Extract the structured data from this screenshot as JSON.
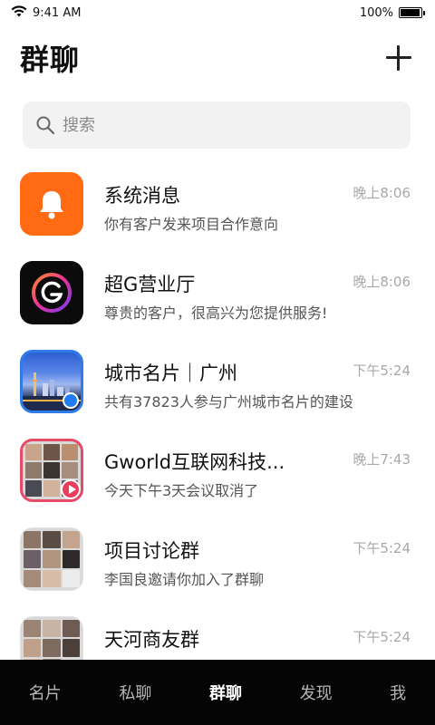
{
  "status_bar": {
    "time": "9:41 AM",
    "battery": "100%",
    "battery_level": 1.0
  },
  "header": {
    "title": "群聊",
    "add_icon": "plus-icon"
  },
  "search": {
    "placeholder": "搜索",
    "icon": "search-icon"
  },
  "chats": [
    {
      "name": "系统消息",
      "preview": "你有客户发来项目合作意向",
      "time": "晚上8:06",
      "avatar": "bell-icon",
      "color": "#ff6a13"
    },
    {
      "name": "超G营业厅",
      "preview": "尊贵的客户，很高兴为您提供服务!",
      "time": "晚上8:06",
      "avatar": "g-logo",
      "color": "#0b0b0b"
    },
    {
      "name": "城市名片｜广州",
      "preview": "共有37823人参与广州城市名片的建设",
      "time": "下午5:24",
      "avatar": "city-photo",
      "color": "#2f7be8"
    },
    {
      "name": "Gworld互联网科技...",
      "preview": "今天下午3天会议取消了",
      "time": "晚上7:43",
      "avatar": "group-collage",
      "color": "#e54a67"
    },
    {
      "name": "项目讨论群",
      "preview": "李国良邀请你加入了群聊",
      "time": "下午5:24",
      "avatar": "group-collage",
      "color": "#d9d9d9"
    },
    {
      "name": "天河商友群",
      "preview": "",
      "time": "下午5:24",
      "avatar": "group-collage",
      "color": "#d9d9d9"
    }
  ],
  "tabs": [
    {
      "label": "名片",
      "active": false
    },
    {
      "label": "私聊",
      "active": false
    },
    {
      "label": "群聊",
      "active": true
    },
    {
      "label": "发现",
      "active": false
    },
    {
      "label": "我",
      "active": false
    }
  ]
}
